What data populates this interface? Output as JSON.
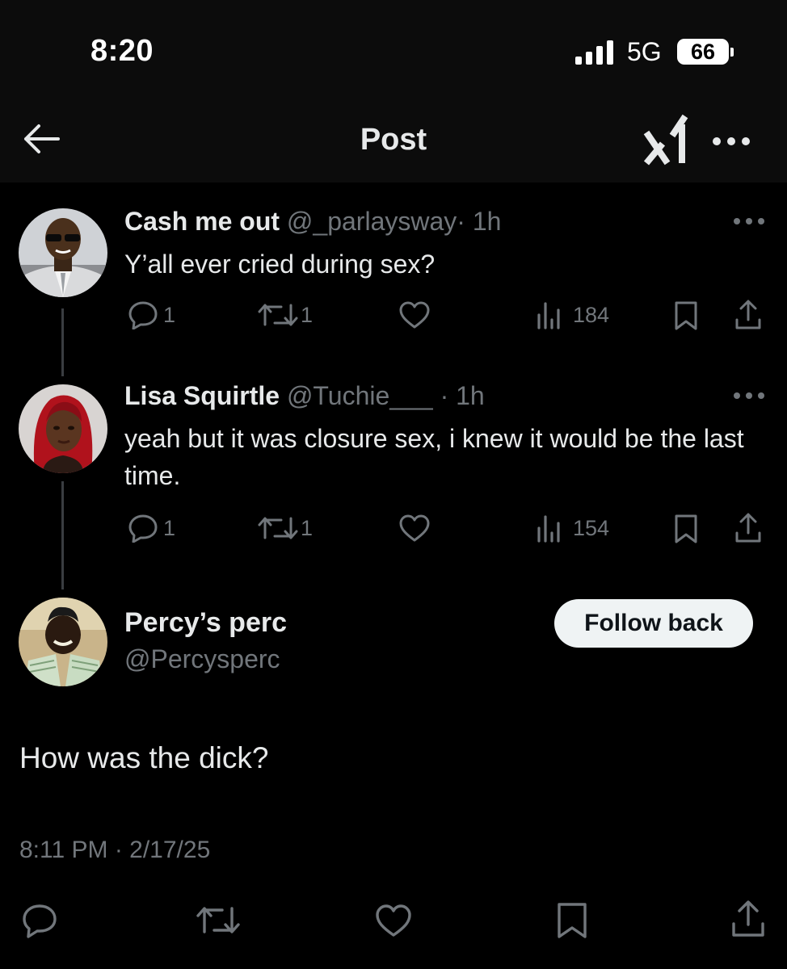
{
  "status_bar": {
    "time": "8:20",
    "network": "5G",
    "battery": "66"
  },
  "nav": {
    "title": "Post"
  },
  "thread": [
    {
      "name": "Cash me out",
      "handle": "@_parlaysway",
      "age": "· 1h",
      "text": "Y’all ever cried during sex?",
      "replies": "1",
      "reposts": "1",
      "views": "184"
    },
    {
      "name": "Lisa Squirtle",
      "handle": "@Tuchie___",
      "age": "· 1h",
      "text": "yeah but it was closure sex, i knew it would be the last time.",
      "replies": "1",
      "reposts": "1",
      "views": "154"
    }
  ],
  "main_post": {
    "name": "Percy’s perc",
    "handle": "@Percysperc",
    "follow_label": "Follow back",
    "text": "How was the dick?",
    "timestamp": "8:11 PM · 2/17/25"
  },
  "colors": {
    "background": "#000000",
    "text": "#e7e9ea",
    "muted": "#71767b",
    "thread_line": "#3a3d41"
  }
}
